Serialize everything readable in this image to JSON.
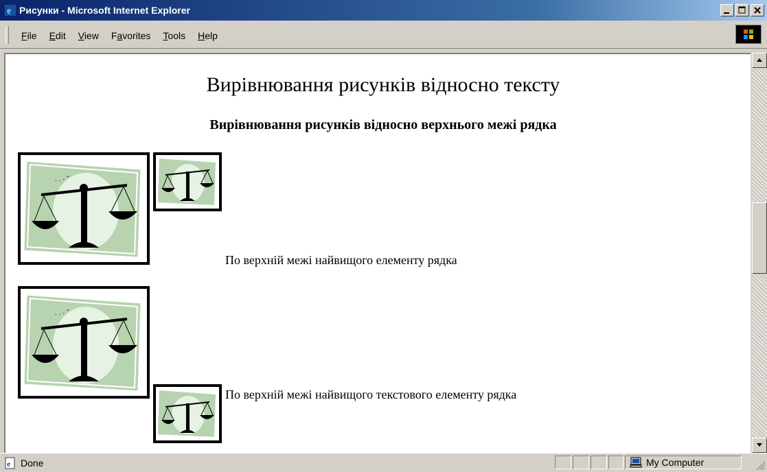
{
  "window": {
    "title": "Рисунки - Microsoft Internet Explorer"
  },
  "menu": {
    "items": [
      {
        "accel": "F",
        "rest": "ile"
      },
      {
        "accel": "E",
        "rest": "dit"
      },
      {
        "accel": "V",
        "rest": "iew"
      },
      {
        "pre": "F",
        "accel": "a",
        "rest": "vorites"
      },
      {
        "accel": "T",
        "rest": "ools"
      },
      {
        "accel": "H",
        "rest": "elp"
      }
    ]
  },
  "page": {
    "heading": "Вирівнювання рисунків відносно тексту",
    "subheading": "Вирівнювання рисунків відносно верхнього межі рядка",
    "rows": [
      {
        "text": "По верхній межі найвищого елементу рядка"
      },
      {
        "text": "По верхній межі найвищого текстового елементу рядка"
      }
    ]
  },
  "status": {
    "text": "Done",
    "zone": "My Computer"
  },
  "icons": {
    "app": "ie-icon",
    "windows_logo": "windows-logo-icon",
    "zone": "computer-icon",
    "image": "scales-of-justice-icon"
  },
  "colors": {
    "titlebar_start": "#0a246a",
    "titlebar_end": "#a6caf0",
    "chrome": "#d4d0c8",
    "image_frame": "#b7d3b0"
  }
}
